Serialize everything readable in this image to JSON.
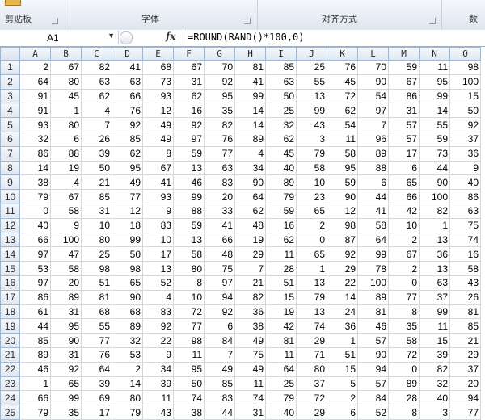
{
  "ribbon": {
    "groups": [
      {
        "label": "剪贴板"
      },
      {
        "label": "字体"
      },
      {
        "label": "对齐方式"
      },
      {
        "label": "数"
      }
    ]
  },
  "formula_bar": {
    "name_box": "A1",
    "fx_label": "fx",
    "formula": "=ROUND(RAND()*100,0)"
  },
  "columns": [
    "A",
    "B",
    "C",
    "D",
    "E",
    "F",
    "G",
    "H",
    "I",
    "J",
    "K",
    "L",
    "M",
    "N",
    "O"
  ],
  "rows": [
    {
      "n": "1",
      "cells": [
        2,
        67,
        82,
        41,
        68,
        67,
        70,
        81,
        85,
        25,
        76,
        70,
        59,
        11,
        98
      ]
    },
    {
      "n": "2",
      "cells": [
        64,
        80,
        63,
        63,
        73,
        31,
        92,
        41,
        63,
        55,
        45,
        90,
        67,
        95,
        100
      ]
    },
    {
      "n": "3",
      "cells": [
        91,
        45,
        62,
        66,
        93,
        62,
        95,
        99,
        50,
        13,
        72,
        54,
        86,
        99,
        15
      ]
    },
    {
      "n": "4",
      "cells": [
        91,
        1,
        4,
        76,
        12,
        16,
        35,
        14,
        25,
        99,
        62,
        97,
        31,
        14,
        50
      ]
    },
    {
      "n": "5",
      "cells": [
        93,
        80,
        7,
        92,
        49,
        92,
        82,
        14,
        32,
        43,
        54,
        7,
        57,
        55,
        92
      ]
    },
    {
      "n": "6",
      "cells": [
        32,
        6,
        26,
        85,
        49,
        97,
        76,
        89,
        62,
        3,
        11,
        96,
        57,
        59,
        37
      ]
    },
    {
      "n": "7",
      "cells": [
        86,
        88,
        39,
        62,
        8,
        59,
        77,
        4,
        45,
        79,
        58,
        89,
        17,
        73,
        36
      ]
    },
    {
      "n": "8",
      "cells": [
        14,
        19,
        50,
        95,
        67,
        13,
        63,
        34,
        40,
        58,
        95,
        88,
        6,
        44,
        9
      ]
    },
    {
      "n": "9",
      "cells": [
        38,
        4,
        21,
        49,
        41,
        46,
        83,
        90,
        89,
        10,
        59,
        6,
        65,
        90,
        40
      ]
    },
    {
      "n": "10",
      "cells": [
        79,
        67,
        85,
        77,
        93,
        99,
        20,
        64,
        79,
        23,
        90,
        44,
        66,
        100,
        86
      ]
    },
    {
      "n": "11",
      "cells": [
        0,
        58,
        31,
        12,
        9,
        88,
        33,
        62,
        59,
        65,
        12,
        41,
        42,
        82,
        63
      ]
    },
    {
      "n": "12",
      "cells": [
        40,
        9,
        10,
        18,
        83,
        59,
        41,
        48,
        16,
        2,
        98,
        58,
        10,
        1,
        75
      ]
    },
    {
      "n": "13",
      "cells": [
        66,
        100,
        80,
        99,
        10,
        13,
        66,
        19,
        62,
        0,
        87,
        64,
        2,
        13,
        74
      ]
    },
    {
      "n": "14",
      "cells": [
        97,
        47,
        25,
        50,
        17,
        58,
        48,
        29,
        11,
        65,
        92,
        99,
        67,
        36,
        16
      ]
    },
    {
      "n": "15",
      "cells": [
        53,
        58,
        98,
        98,
        13,
        80,
        75,
        7,
        28,
        1,
        29,
        78,
        2,
        13,
        58
      ]
    },
    {
      "n": "16",
      "cells": [
        97,
        20,
        51,
        65,
        52,
        8,
        97,
        21,
        51,
        13,
        22,
        100,
        0,
        63,
        43
      ]
    },
    {
      "n": "17",
      "cells": [
        86,
        89,
        81,
        90,
        4,
        10,
        94,
        82,
        15,
        79,
        14,
        89,
        77,
        37,
        26
      ]
    },
    {
      "n": "18",
      "cells": [
        61,
        31,
        68,
        68,
        83,
        72,
        92,
        36,
        19,
        13,
        24,
        81,
        8,
        99,
        81
      ]
    },
    {
      "n": "19",
      "cells": [
        44,
        95,
        55,
        89,
        92,
        77,
        6,
        38,
        42,
        74,
        36,
        46,
        35,
        11,
        85
      ]
    },
    {
      "n": "20",
      "cells": [
        85,
        90,
        77,
        32,
        22,
        98,
        84,
        49,
        81,
        29,
        1,
        57,
        58,
        15,
        21
      ]
    },
    {
      "n": "21",
      "cells": [
        89,
        31,
        76,
        53,
        9,
        11,
        7,
        75,
        11,
        71,
        51,
        90,
        72,
        39,
        29
      ]
    },
    {
      "n": "22",
      "cells": [
        46,
        92,
        64,
        2,
        34,
        95,
        49,
        49,
        64,
        80,
        15,
        94,
        0,
        82,
        37
      ]
    },
    {
      "n": "23",
      "cells": [
        1,
        65,
        39,
        14,
        39,
        50,
        85,
        11,
        25,
        37,
        5,
        57,
        89,
        32,
        20
      ]
    },
    {
      "n": "24",
      "cells": [
        66,
        99,
        69,
        80,
        11,
        74,
        83,
        74,
        79,
        72,
        2,
        84,
        28,
        40,
        94
      ]
    },
    {
      "n": "25",
      "cells": [
        79,
        35,
        17,
        79,
        43,
        38,
        44,
        31,
        40,
        29,
        6,
        52,
        8,
        3,
        77
      ]
    }
  ]
}
